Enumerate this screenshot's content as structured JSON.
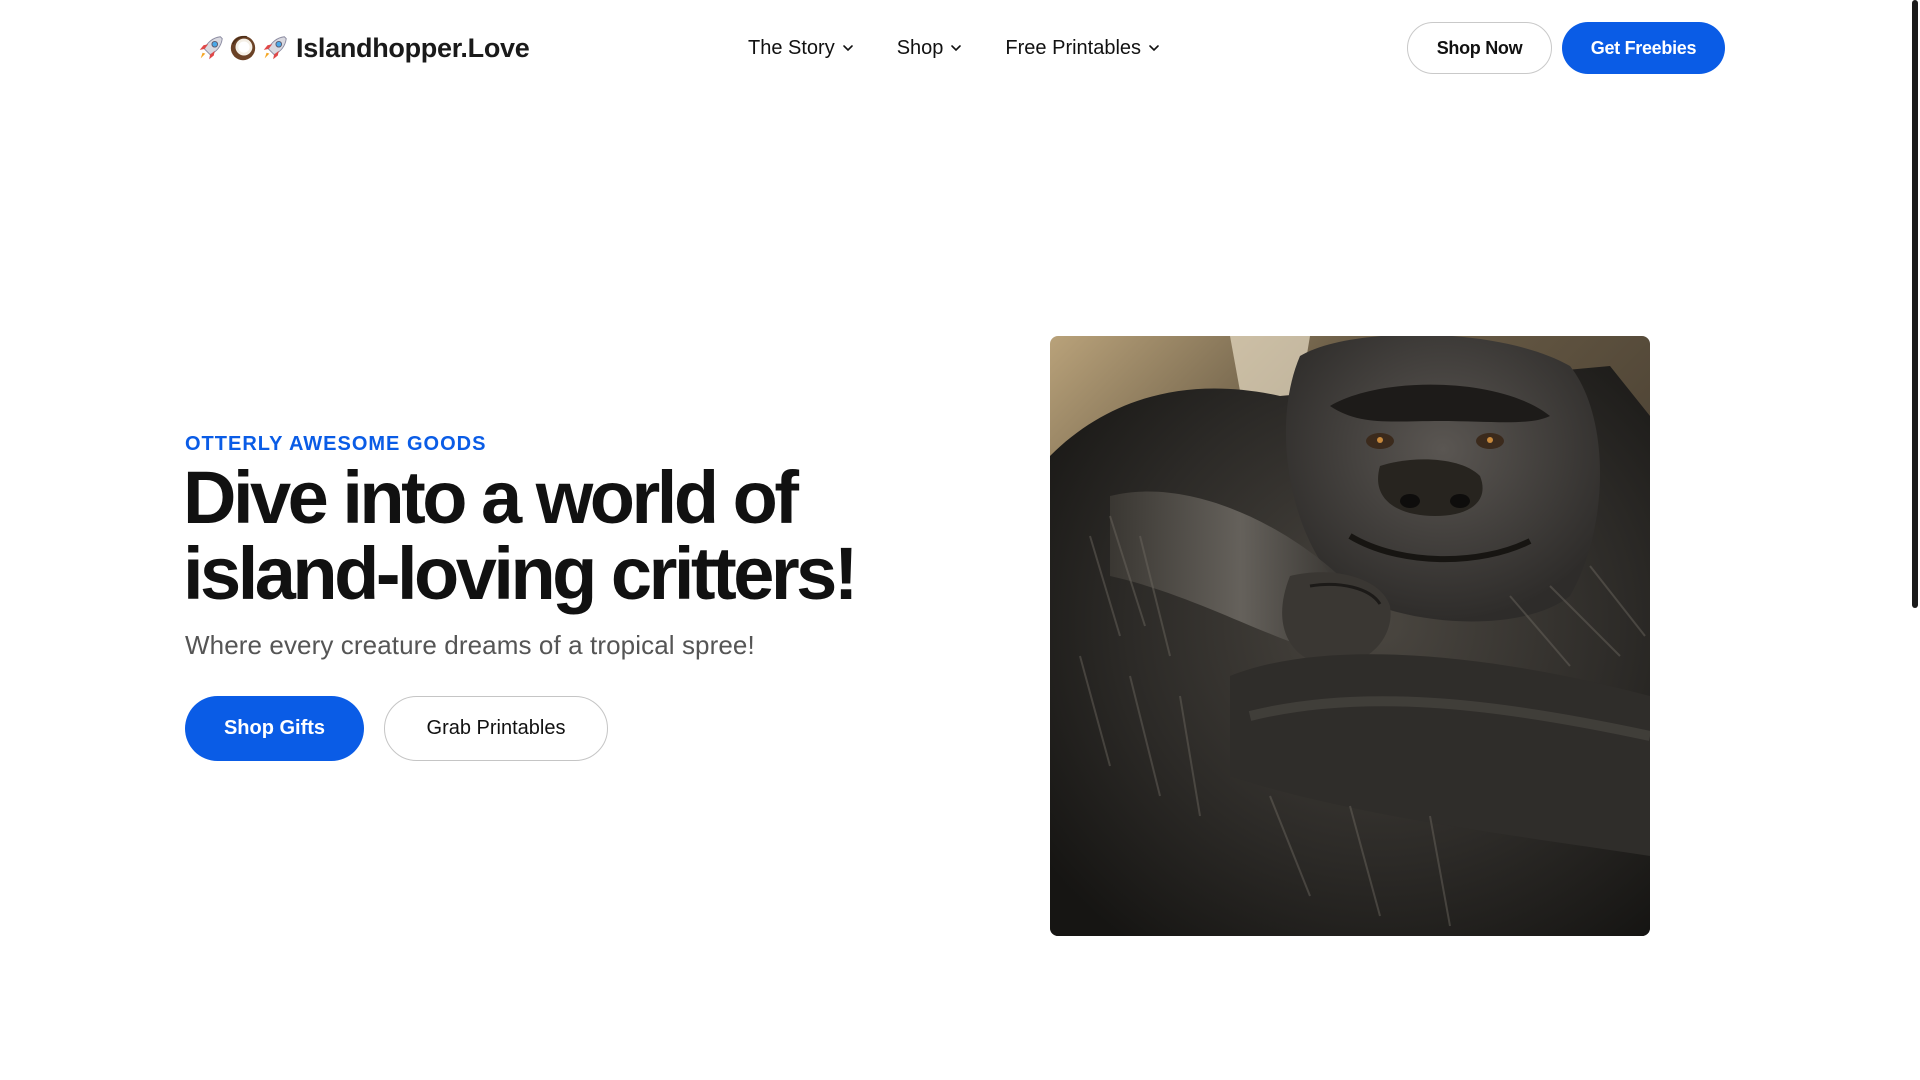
{
  "header": {
    "logo_text": "Islandhopper.Love",
    "logo_icons": [
      "rocket-icon",
      "coconut-icon",
      "rocket-icon"
    ],
    "nav": [
      {
        "label": "The Story"
      },
      {
        "label": "Shop"
      },
      {
        "label": "Free Printables"
      }
    ],
    "shop_now_label": "Shop Now",
    "get_freebies_label": "Get Freebies"
  },
  "hero": {
    "eyebrow": "OTTERLY AWESOME GOODS",
    "headline_line1": "Dive into a world of",
    "headline_line2": "island-loving critters!",
    "subhead": "Where every creature dreams of a tropical spree!",
    "primary_cta": "Shop Gifts",
    "secondary_cta": "Grab Printables",
    "image_subject": "gorilla"
  },
  "colors": {
    "accent": "#0a5ce6",
    "text": "#111111",
    "muted": "#555555"
  }
}
